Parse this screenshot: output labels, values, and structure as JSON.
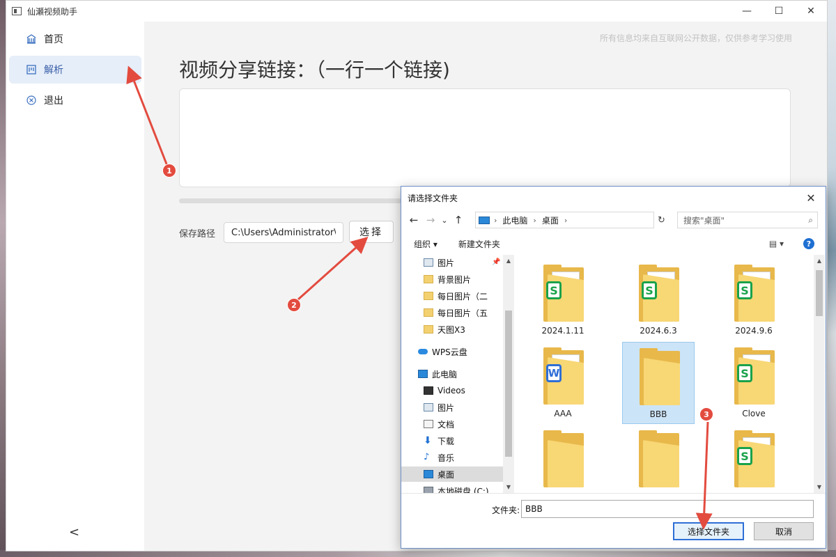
{
  "app": {
    "title": "仙瀬视频助手",
    "window_controls": {
      "minimize": "—",
      "maximize": "☐",
      "close": "✕"
    }
  },
  "sidebar": {
    "items": [
      {
        "label": "首页",
        "icon": "home-icon",
        "active": false
      },
      {
        "label": "解析",
        "icon": "parse-icon",
        "active": true
      },
      {
        "label": "退出",
        "icon": "exit-icon",
        "active": false
      }
    ],
    "collapse_glyph": "<"
  },
  "main": {
    "notice": "所有信息均来自互联网公开数据，仅供参考学习使用",
    "heading": "视频分享链接：（一行一个链接)",
    "textarea_value": "",
    "save_path_label": "保存路径",
    "save_path_value": "C:\\Users\\Administrator\\[",
    "choose_button": "选择"
  },
  "dialog": {
    "title": "请选择文件夹",
    "close_glyph": "✕",
    "nav": {
      "back": "←",
      "forward": "→",
      "dropdown": "⌄",
      "up": "↑"
    },
    "breadcrumb": [
      "此电脑",
      "桌面"
    ],
    "search_placeholder": "搜索\"桌面\"",
    "toolbar": {
      "organize": "组织 ▾",
      "new_folder": "新建文件夹",
      "view": "▤ ▾",
      "help": "?"
    },
    "tree": [
      {
        "label": "图片",
        "icon": "pictures-icon",
        "pinned": true
      },
      {
        "label": "背景图片",
        "icon": "folder-icon"
      },
      {
        "label": "每日图片（二",
        "icon": "folder-icon"
      },
      {
        "label": "每日图片（五",
        "icon": "folder-icon"
      },
      {
        "label": "天图X3",
        "icon": "folder-icon"
      },
      {
        "label": "WPS云盘",
        "icon": "cloud-icon"
      },
      {
        "label": "此电脑",
        "icon": "computer-icon"
      },
      {
        "label": "Videos",
        "icon": "videos-icon"
      },
      {
        "label": "图片",
        "icon": "pictures-icon"
      },
      {
        "label": "文档",
        "icon": "documents-icon"
      },
      {
        "label": "下载",
        "icon": "downloads-icon"
      },
      {
        "label": "音乐",
        "icon": "music-icon"
      },
      {
        "label": "桌面",
        "icon": "desktop-icon",
        "selected": true
      },
      {
        "label": "本地磁盘 (C:)",
        "icon": "disk-icon"
      }
    ],
    "files": [
      {
        "name": "2024.1.11",
        "badge": "S"
      },
      {
        "name": "2024.6.3",
        "badge": "S"
      },
      {
        "name": "2024.9.6",
        "badge": "S"
      },
      {
        "name": "AAA",
        "badge": "W"
      },
      {
        "name": "BBB",
        "badge": "",
        "selected": true
      },
      {
        "name": "Clove",
        "badge": "S"
      },
      {
        "name": "",
        "badge": ""
      },
      {
        "name": "",
        "badge": ""
      },
      {
        "name": "",
        "badge": "S"
      }
    ],
    "folder_label": "文件夹:",
    "folder_value": "BBB",
    "select_button": "选择文件夹",
    "cancel_button": "取消"
  },
  "annotations": {
    "markers": [
      "1",
      "2",
      "3"
    ],
    "color": "#e34b3f"
  }
}
